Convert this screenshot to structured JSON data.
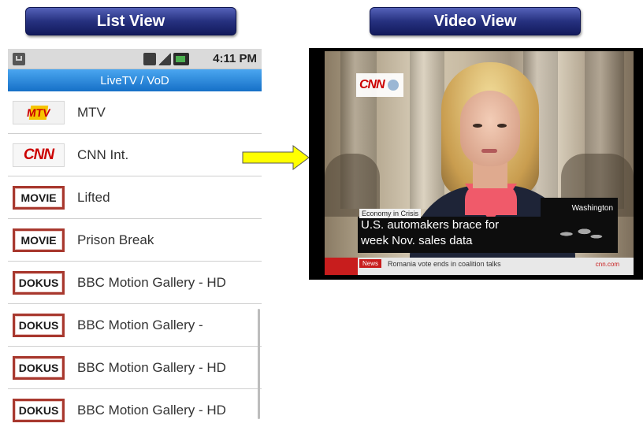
{
  "headers": {
    "list_view": "List View",
    "video_view": "Video View"
  },
  "phone": {
    "status_time": "4:11 PM",
    "title": "LiveTV / VoD",
    "items": [
      {
        "logo": "MTV",
        "logo_type": "mtv",
        "label": "MTV"
      },
      {
        "logo": "CNN",
        "logo_type": "cnn",
        "label": "CNN Int."
      },
      {
        "logo": "MOVIE",
        "logo_type": "movie",
        "label": "Lifted"
      },
      {
        "logo": "MOVIE",
        "logo_type": "movie",
        "label": "Prison Break"
      },
      {
        "logo": "DOKUS",
        "logo_type": "dokus",
        "label": "BBC Motion Gallery - HD"
      },
      {
        "logo": "DOKUS",
        "logo_type": "dokus",
        "label": "BBC Motion Gallery -"
      },
      {
        "logo": "DOKUS",
        "logo_type": "dokus",
        "label": "BBC Motion Gallery - HD"
      },
      {
        "logo": "DOKUS",
        "logo_type": "dokus",
        "label": "BBC Motion Gallery - HD"
      }
    ]
  },
  "video": {
    "channel_bug": "CNN",
    "kicker": "Economy in Crisis",
    "headline_line1": "U.S. automakers brace for",
    "headline_line2": "week Nov. sales data",
    "location": "Washington",
    "ticker_tag": "News",
    "ticker_text": "Romania vote ends in coalition talks",
    "ticker_site": "cnn.com"
  },
  "colors": {
    "header_blue": "#26317f",
    "title_bar_blue": "#1670c7",
    "arrow_yellow": "#ffff00",
    "cnn_red": "#cc0000"
  },
  "icons": {
    "arrow": "arrow-right-icon",
    "status_left": "notification-icon",
    "status_right": [
      "network-icon",
      "signal-icon",
      "battery-icon"
    ]
  }
}
